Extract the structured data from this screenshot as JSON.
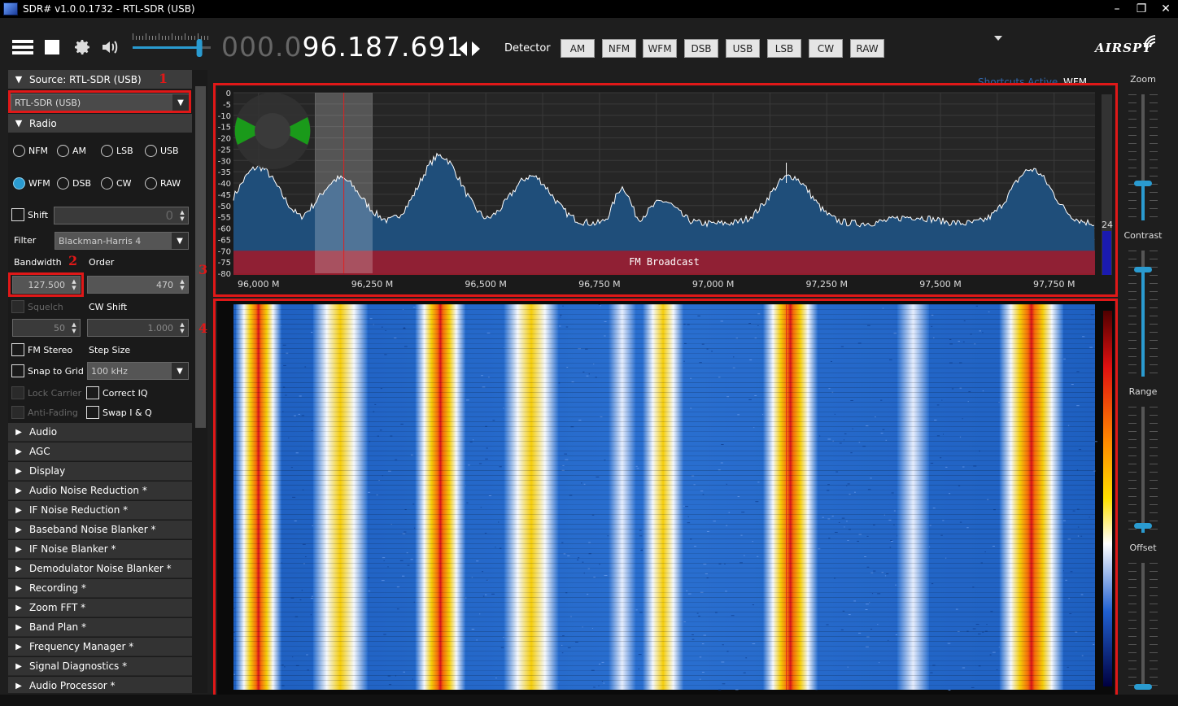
{
  "window": {
    "title": "SDR# v1.0.0.1732 - RTL-SDR (USB)",
    "minimize": "–",
    "maximize": "❐",
    "close": "✕"
  },
  "toolbar": {
    "freq_dim": "000.0",
    "freq_bright": "96.187.691",
    "detector_label": "Detector",
    "detectors": [
      "AM",
      "NFM",
      "WFM",
      "DSB",
      "USB",
      "LSB",
      "CW",
      "RAW"
    ],
    "brand": "AIRSPY",
    "volume_level": 0.85
  },
  "source": {
    "header": "Source: RTL-SDR (USB)",
    "device": "RTL-SDR (USB)"
  },
  "radio": {
    "header": "Radio",
    "modes": [
      "NFM",
      "AM",
      "LSB",
      "USB",
      "WFM",
      "DSB",
      "CW",
      "RAW"
    ],
    "selected_mode": "WFM",
    "shift_label": "Shift",
    "shift_value": "0",
    "filter_label": "Filter",
    "filter_value": "Blackman-Harris 4",
    "bandwidth_label": "Bandwidth",
    "bandwidth_value": "127.500",
    "order_label": "Order",
    "order_value": "470",
    "squelch_label": "Squelch",
    "squelch_value": "50",
    "cwshift_label": "CW Shift",
    "cwshift_value": "1.000",
    "fmstereo_label": "FM Stereo",
    "stepsize_label": "Step Size",
    "snap_label": "Snap to Grid",
    "step_value": "100 kHz",
    "lock_label": "Lock Carrier",
    "correctiq_label": "Correct IQ",
    "antifading_label": "Anti-Fading",
    "swapiq_label": "Swap I & Q"
  },
  "sections": [
    "Audio",
    "AGC",
    "Display",
    "Audio Noise Reduction *",
    "IF Noise Reduction *",
    "Baseband Noise Blanker *",
    "IF Noise Blanker *",
    "Demodulator Noise Blanker *",
    "Recording *",
    "Zoom FFT *",
    "Band Plan *",
    "Frequency Manager *",
    "Signal Diagnostics *",
    "Audio Processor *"
  ],
  "annotations": [
    "1",
    "2",
    "3",
    "4"
  ],
  "spectrum": {
    "shortcuts": "Shortcuts Active",
    "mode": "WFM",
    "band_label": "FM Broadcast",
    "y_ticks": [
      "0",
      "-5",
      "-10",
      "-15",
      "-20",
      "-25",
      "-30",
      "-35",
      "-40",
      "-45",
      "-50",
      "-55",
      "-60",
      "-65",
      "-70",
      "-75",
      "-80"
    ],
    "x_ticks": [
      "96,000 M",
      "96,250 M",
      "96,500 M",
      "96,750 M",
      "97,000 M",
      "97,250 M",
      "97,500 M",
      "97,750 M"
    ],
    "side_value": "24",
    "x_range_mhz": [
      95.945,
      97.84
    ],
    "y_range_db": [
      -80,
      0
    ],
    "tuned_mhz": 96.1877,
    "filter_mhz": [
      96.124,
      96.251
    ],
    "peaks": [
      {
        "mhz": 96.0,
        "db": -33
      },
      {
        "mhz": 96.18,
        "db": -38
      },
      {
        "mhz": 96.4,
        "db": -28
      },
      {
        "mhz": 96.6,
        "db": -37
      },
      {
        "mhz": 96.8,
        "db": -42
      },
      {
        "mhz": 96.89,
        "db": -48
      },
      {
        "mhz": 97.17,
        "db": -37
      },
      {
        "mhz": 97.44,
        "db": -55
      },
      {
        "mhz": 97.7,
        "db": -34
      }
    ]
  },
  "rightpanel": {
    "zoom": "Zoom",
    "contrast": "Contrast",
    "range": "Range",
    "offset": "Offset"
  },
  "colors": {
    "accent": "#2a9bd0",
    "annotation": "#e01818",
    "spectrum_fill": "#1f4e7a",
    "band": "#9a1c2e"
  }
}
